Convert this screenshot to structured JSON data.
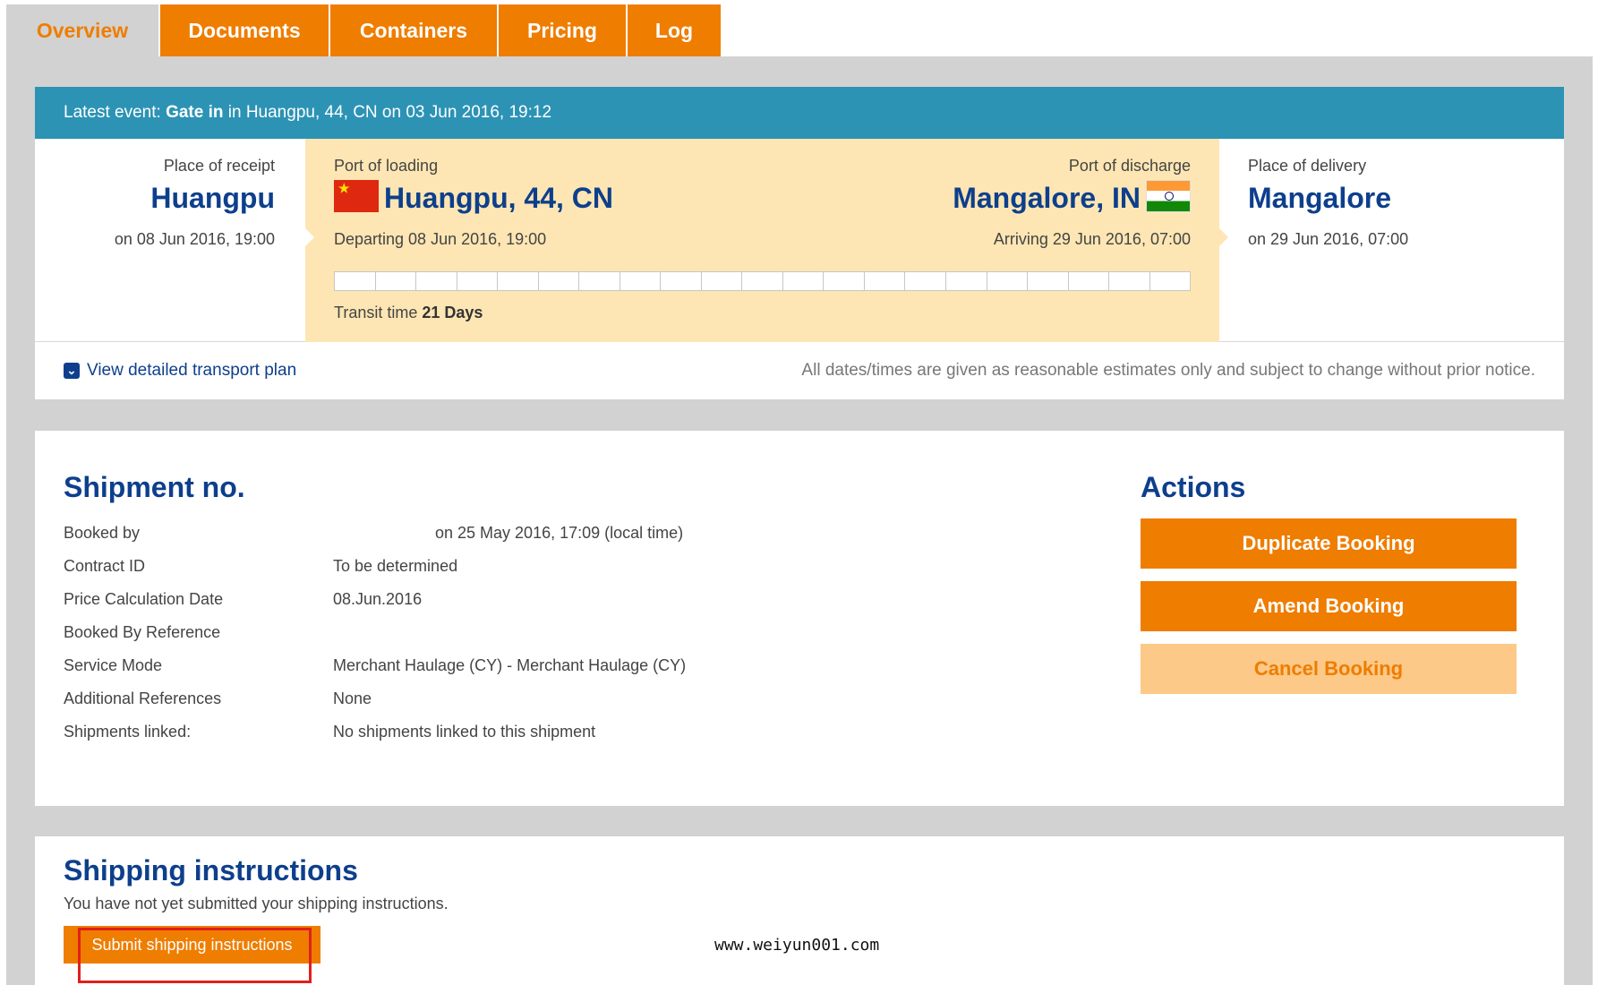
{
  "tabs": [
    {
      "label": "Overview",
      "active": true
    },
    {
      "label": "Documents",
      "active": false
    },
    {
      "label": "Containers",
      "active": false
    },
    {
      "label": "Pricing",
      "active": false
    },
    {
      "label": "Log",
      "active": false
    }
  ],
  "route": {
    "latest_event_prefix": "Latest event: ",
    "latest_event_name": "Gate in",
    "latest_event_suffix": " in Huangpu, 44, CN on 03 Jun 2016, 19:12",
    "receipt": {
      "label": "Place of receipt",
      "place": "Huangpu",
      "when": "on 08 Jun 2016, 19:00"
    },
    "loading": {
      "label": "Port of loading",
      "place": "Huangpu, 44, CN",
      "when": "Departing 08 Jun 2016, 19:00",
      "flag": "cn-flag-icon"
    },
    "discharge": {
      "label": "Port of discharge",
      "place": "Mangalore, IN",
      "when": "Arriving 29 Jun 2016, 07:00",
      "flag": "in-flag-icon"
    },
    "delivery": {
      "label": "Place of delivery",
      "place": "Mangalore",
      "when": "on 29 Jun 2016, 07:00"
    },
    "transit_prefix": "Transit time ",
    "transit_value": "21 Days",
    "plan_link": "View detailed transport plan",
    "disclaimer": "All dates/times are given as reasonable estimates only and subject to change without prior notice."
  },
  "shipment": {
    "title": "Shipment no.",
    "fields": [
      {
        "key": "Booked by",
        "value": "on 25 May 2016, 17:09 (local time)"
      },
      {
        "key": "Contract ID",
        "value": "To be determined"
      },
      {
        "key": "Price Calculation Date",
        "value": "08.Jun.2016"
      },
      {
        "key": "Booked By Reference",
        "value": ""
      },
      {
        "key": "Service Mode",
        "value": "Merchant Haulage (CY) - Merchant Haulage (CY)"
      },
      {
        "key": "Additional References",
        "value": "None"
      },
      {
        "key": "Shipments linked:",
        "value": "No shipments linked to this shipment"
      }
    ]
  },
  "actions": {
    "title": "Actions",
    "duplicate": "Duplicate Booking",
    "amend": "Amend Booking",
    "cancel": "Cancel Booking"
  },
  "shipping_instructions": {
    "title": "Shipping instructions",
    "text": "You have not yet submitted your shipping instructions.",
    "button": "Submit shipping instructions"
  },
  "watermark": "www.weiyun001.com",
  "colors": {
    "accent": "#ee7d00",
    "header": "#2c93b5",
    "brand_blue": "#0d3f8c",
    "highlight": "#e0201c"
  }
}
